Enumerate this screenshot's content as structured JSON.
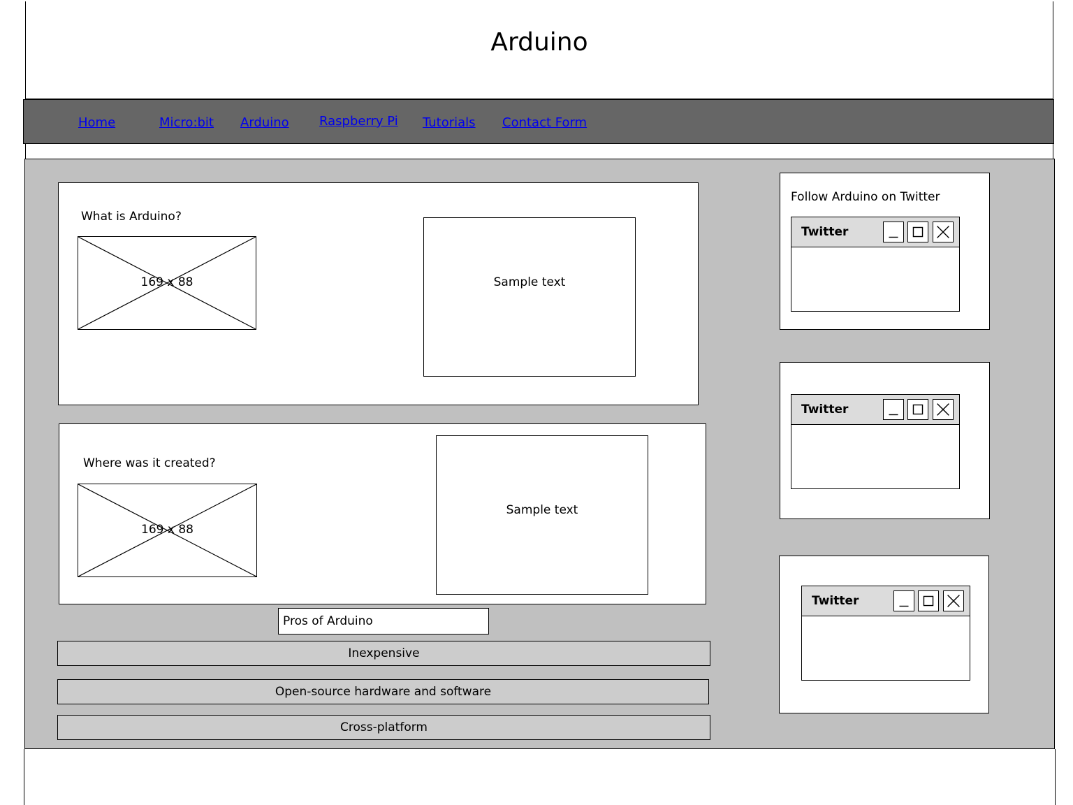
{
  "header": {
    "title": "Arduino"
  },
  "nav": {
    "links": [
      "Home",
      "Micro:bit",
      "Arduino",
      "Raspberry Pi",
      "Tutorials",
      "Contact Form"
    ]
  },
  "sections": [
    {
      "heading": "What is Arduino?",
      "image_label": "169 x 88",
      "sample": "Sample text"
    },
    {
      "heading": "Where was it created?",
      "image_label": "169 x 88",
      "sample": "Sample text"
    }
  ],
  "pros": {
    "title": "Pros of Arduino",
    "items": [
      "Inexpensive",
      "Open-source hardware and software",
      "Cross-platform"
    ]
  },
  "sidebar": {
    "follow_label": "Follow Arduino on Twitter",
    "widgets": [
      {
        "title": "Twitter"
      },
      {
        "title": "Twitter"
      },
      {
        "title": "Twitter"
      }
    ],
    "icons": [
      "minimize-icon",
      "maximize-icon",
      "close-icon"
    ]
  }
}
